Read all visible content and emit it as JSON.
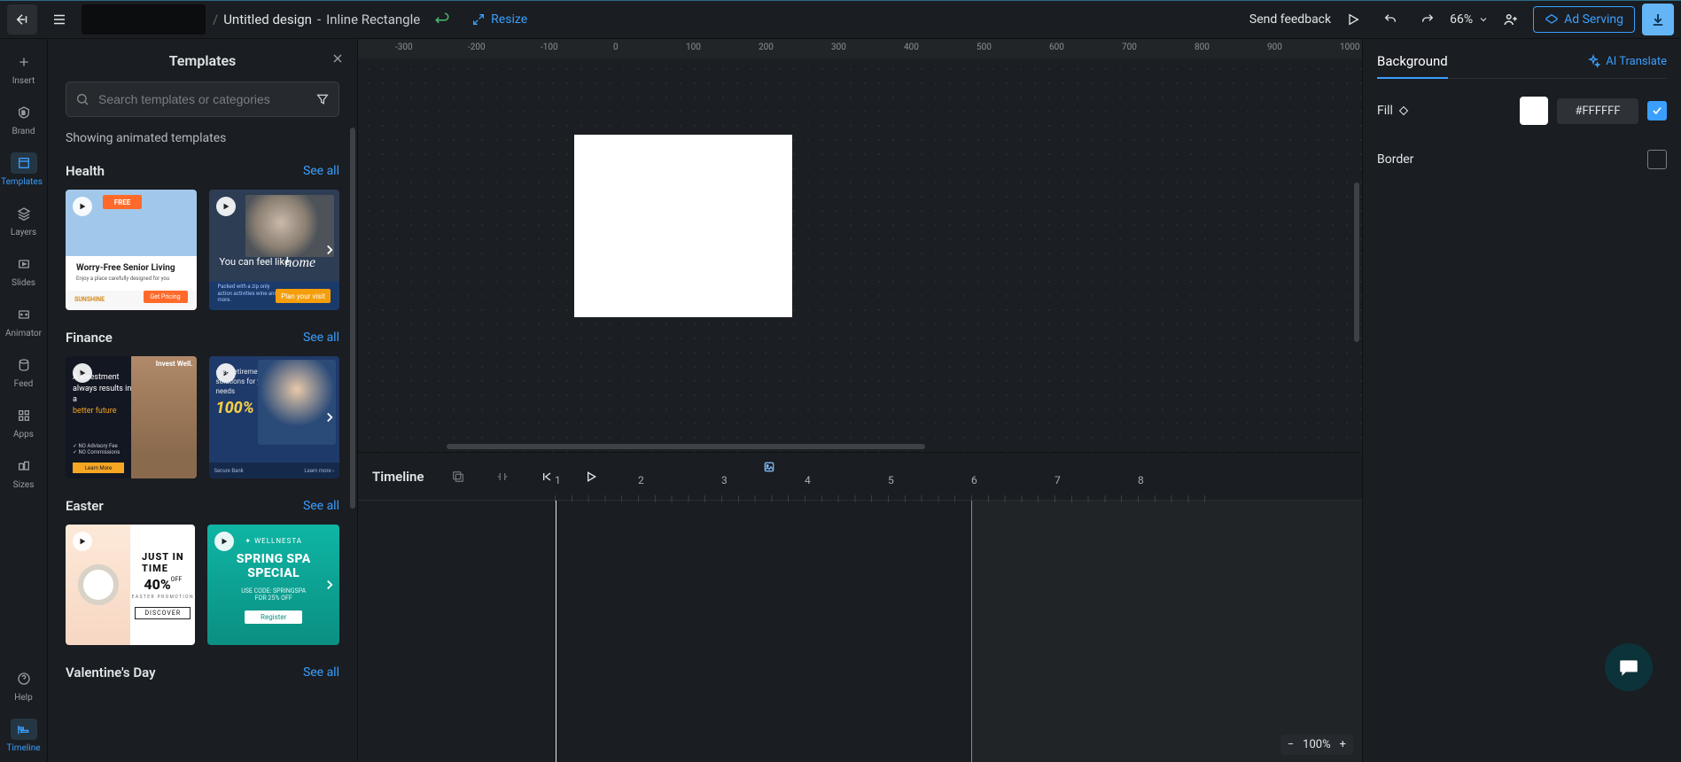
{
  "topbar": {
    "breadcrumb": {
      "slash": "/",
      "title": "Untitled design",
      "sep": " - ",
      "subtitle": "Inline Rectangle"
    },
    "resize": "Resize",
    "feedback": "Send feedback",
    "zoom": "66%",
    "ad_serving": "Ad Serving"
  },
  "rail": {
    "insert": "Insert",
    "brand": "Brand",
    "templates": "Templates",
    "layers": "Layers",
    "slides": "Slides",
    "animator": "Animator",
    "feed": "Feed",
    "apps": "Apps",
    "sizes": "Sizes",
    "help": "Help",
    "timeline": "Timeline"
  },
  "tpanel": {
    "title": "Templates",
    "search_ph": "Search templates or categories",
    "showing": "Showing animated templates",
    "see_all": "See all",
    "cats": [
      {
        "name": "Health",
        "cards": [
          {
            "tag": "FREE",
            "title": "Worry-Free Senior Living",
            "sub": "Enjoy a place carefully designed for you",
            "cta": "Get Pricing",
            "logo": "SUNSHINE"
          },
          {
            "feel": "You can feel like",
            "home": "home",
            "small": "Packed with a zip only action activities wine and more.",
            "cta": "Plan your visit"
          }
        ]
      },
      {
        "name": "Finance",
        "cards": [
          {
            "iw": "Invest Well.",
            "t": "A\ninvestment\nalways\nresults in a",
            "b": "better future",
            "bul": "✓ NO Advisory Fee\n✓ NO Commissions",
            "cta": "Learn More"
          },
          {
            "txt": "cted retirement solutions for your needs",
            "pct": "100%",
            "l": "Secure Bank",
            "r": "Learn more ›"
          }
        ]
      },
      {
        "name": "Easter",
        "cards": [
          {
            "j": "JUST IN\nTIME",
            "p": "40%",
            "off": "OFF",
            "ep": "EASTER PROMOTION",
            "d": "DISCOVER"
          },
          {
            "lg": "✦ WELLNESTA",
            "t1": "SPRING SPA",
            "t2": "SPECIAL",
            "sm": "USE CODE: SPRINGSPA\nFOR 25% OFF",
            "btn": "Register"
          }
        ]
      },
      {
        "name": "Valentine's Day"
      }
    ]
  },
  "canvas": {
    "ruler_ticks": [
      "-300",
      "-200",
      "-100",
      "0",
      "100",
      "200",
      "300",
      "400",
      "500",
      "600",
      "700",
      "800",
      "900",
      "1000"
    ]
  },
  "timeline": {
    "label": "Timeline",
    "ticks": [
      "1",
      "2",
      "3",
      "4",
      "5",
      "6",
      "7",
      "8"
    ],
    "zoom": "100%"
  },
  "rpanel": {
    "tab_bg": "Background",
    "ai": "AI Translate",
    "fill": "Fill",
    "hex": "#FFFFFF",
    "border": "Border"
  }
}
